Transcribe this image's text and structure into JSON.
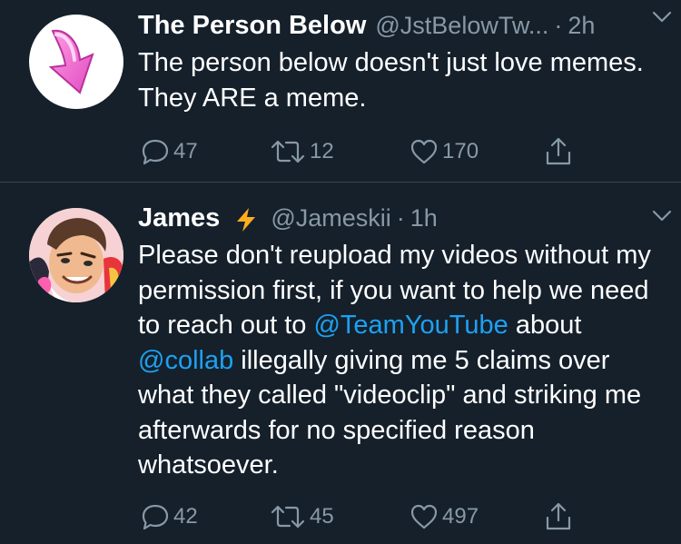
{
  "tweets": [
    {
      "author_name": "The Person Below",
      "handle": "@JstBelowTw...",
      "separator": "·",
      "time": "2h",
      "avatar_icon": "pink-down-arrow-icon",
      "text_parts": [
        {
          "text": "The person below doesn't just love memes. They ARE a meme.",
          "type": "plain"
        }
      ],
      "replies": "47",
      "retweets": "12",
      "likes": "170"
    },
    {
      "author_name": "James",
      "name_icon": "lightning-bolt-icon",
      "handle": "@Jameskii",
      "separator": "·",
      "time": "1h",
      "avatar_icon": "cartoon-character-avatar",
      "text_parts": [
        {
          "text": "Please don't reupload my videos without my permission first, if you want to help we need to reach out to ",
          "type": "plain"
        },
        {
          "text": "@TeamYouTube",
          "type": "mention"
        },
        {
          "text": " about ",
          "type": "plain"
        },
        {
          "text": "@collab",
          "type": "mention"
        },
        {
          "text": " illegally giving me 5 claims over what they called \"videoclip\" and striking me afterwards for no specified reason whatsoever.",
          "type": "plain"
        }
      ],
      "replies": "42",
      "retweets": "45",
      "likes": "497"
    }
  ],
  "colors": {
    "background": "#15202b",
    "primary_text": "#ffffff",
    "secondary_text": "#8899a6",
    "link": "#1da1f2",
    "divider": "#38444d",
    "bolt": "#ffad1f"
  }
}
